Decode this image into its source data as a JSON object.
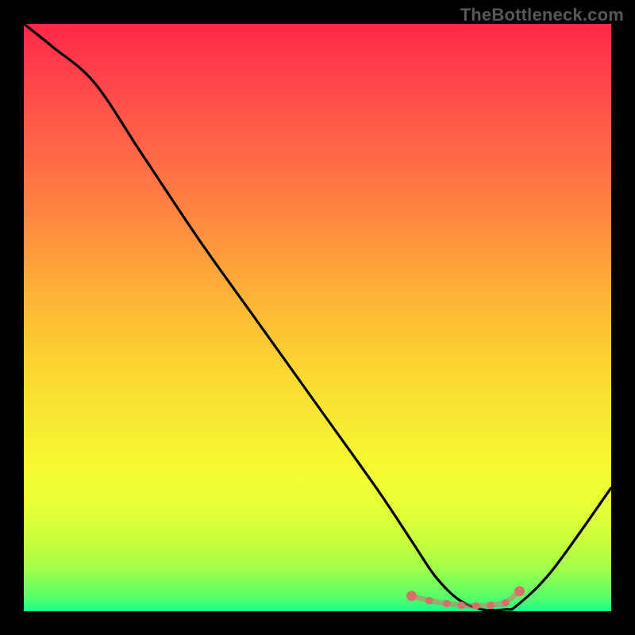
{
  "watermark": "TheBottleneck.com",
  "chart_data": {
    "type": "line",
    "title": "",
    "xlabel": "",
    "ylabel": "",
    "xlim": [
      0,
      100
    ],
    "ylim": [
      0,
      100
    ],
    "series": [
      {
        "name": "curve",
        "x": [
          0,
          5,
          12,
          20,
          30,
          40,
          50,
          60,
          66,
          70,
          74,
          78,
          82,
          84,
          90,
          100
        ],
        "y": [
          100,
          96,
          90,
          78,
          63,
          49,
          35,
          21,
          12,
          6,
          2,
          0.3,
          0.3,
          1,
          7,
          21
        ]
      }
    ],
    "highlight_segment": {
      "name": "dot-band",
      "color": "#d5716b",
      "x": [
        66,
        69,
        72,
        74.5,
        77,
        79.5,
        82,
        84.4
      ],
      "y": [
        2.6,
        1.8,
        1.3,
        1.0,
        0.9,
        1.0,
        1.4,
        3.4
      ]
    },
    "gradient_stops": [
      {
        "pos": 0,
        "color": "#ff2846"
      },
      {
        "pos": 100,
        "color": "#13ff8e"
      }
    ]
  }
}
